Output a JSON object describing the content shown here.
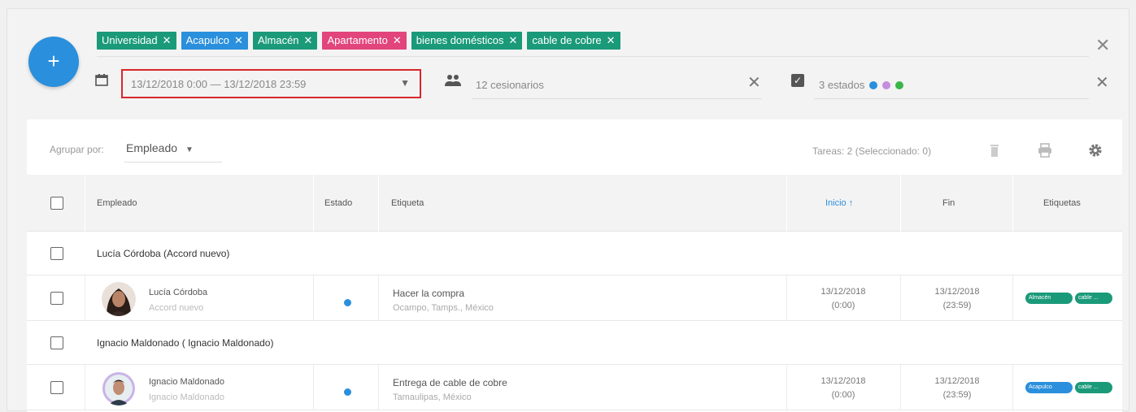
{
  "filters": {
    "chips": [
      {
        "label": "Universidad",
        "color": "#1b9a7a"
      },
      {
        "label": "Acapulco",
        "color": "#2a8fdc"
      },
      {
        "label": "Almacén",
        "color": "#1b9a7a"
      },
      {
        "label": "Apartamento",
        "color": "#e2447c"
      },
      {
        "label": "bienes domésticos",
        "color": "#1b9a7a"
      },
      {
        "label": "cable de cobre",
        "color": "#1b9a7a"
      }
    ],
    "chip_remove_symbol": "✕",
    "clear_symbol": "✕",
    "add_symbol": "+",
    "date_range": "13/12/2018 0:00 — 13/12/2018 23:59",
    "assignees": "12 cesionarios",
    "states_label": "3 estados",
    "state_colors": [
      "#2a8fdc",
      "#c58ce0",
      "#3bb54a"
    ]
  },
  "toolbar": {
    "group_by_label": "Agrupar por:",
    "group_by_value": "Empleado",
    "task_count": "Tareas: 2 (Seleccionado: 0)",
    "icons": [
      "trash-icon",
      "print-icon",
      "gear-icon"
    ]
  },
  "grid": {
    "columns": {
      "employee": "Empleado",
      "state": "Estado",
      "label": "Etiqueta",
      "start": "Inicio",
      "end": "Fin",
      "tags": "Etiquetas"
    },
    "sort_arrow": "↑",
    "groups": [
      {
        "title": "Lucía Córdoba (Accord nuevo)",
        "row": {
          "name": "Lucía Córdoba",
          "company": "Accord nuevo",
          "state_color": "#2a8fdc",
          "task": "Hacer la compra",
          "location": "Ocampo, Tamps., México",
          "start_date": "13/12/2018",
          "start_time": "(0:00)",
          "end_date": "13/12/2018",
          "end_time": "(23:59)",
          "tags": [
            {
              "label": "Almacén",
              "color": "#1b9a7a"
            },
            {
              "label": "cable ...",
              "color": "#1b9a7a"
            }
          ]
        }
      },
      {
        "title": "Ignacio Maldonado ( Ignacio Maldonado)",
        "row": {
          "name": "Ignacio Maldonado",
          "company": "Ignacio Maldonado",
          "state_color": "#2a8fdc",
          "task": "Entrega de cable de cobre",
          "location": "Tamaulipas, México",
          "start_date": "13/12/2018",
          "start_time": "(0:00)",
          "end_date": "13/12/2018",
          "end_time": "(23:59)",
          "tags": [
            {
              "label": "Acapulco",
              "color": "#2a8fdc"
            },
            {
              "label": "cable ...",
              "color": "#1b9a7a"
            }
          ]
        }
      }
    ]
  }
}
